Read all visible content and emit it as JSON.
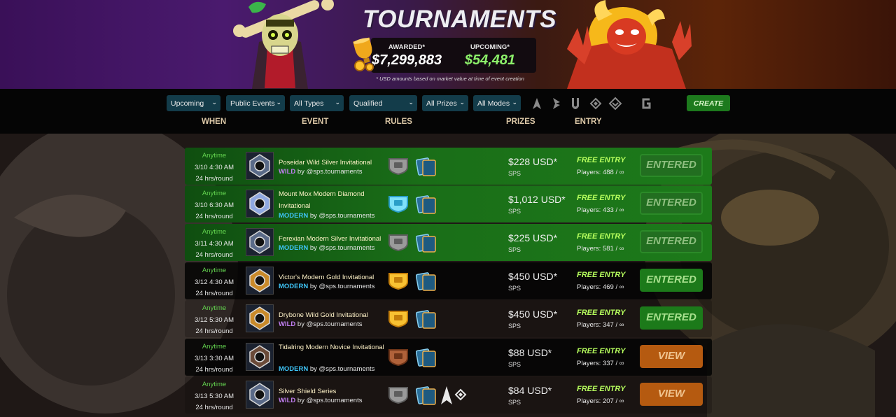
{
  "header": {
    "title": "TOURNAMENTS",
    "awarded_label": "AWARDED*",
    "awarded_value": "$7,299,883",
    "upcoming_label": "UPCOMING*",
    "upcoming_value": "$54,481",
    "footnote": "* USD amounts based on market value at time of event creation"
  },
  "filters": {
    "status": "Upcoming",
    "visibility": "Public Events",
    "types": "All Types",
    "rules": "Qualified",
    "prizes": "All Prizes",
    "modes": "All Modes",
    "create_label": "CREATE",
    "format_icons": [
      "format-a-icon",
      "format-b-icon",
      "format-u-icon",
      "format-diamond-icon",
      "format-chevron-icon",
      "format-g-icon"
    ]
  },
  "columns": {
    "when": "WHEN",
    "event": "EVENT",
    "rules": "RULES",
    "prizes": "PRIZES",
    "entry": "ENTRY"
  },
  "rows": [
    {
      "style": "green",
      "when": [
        "Anytime",
        "3/10 4:30 AM",
        "24 hrs/round"
      ],
      "title": "Poseidar Wild Silver Invitational",
      "format": "WILD",
      "by": "by @sps.tournaments",
      "league": "silver",
      "prize": "$228 USD*",
      "token": "SPS",
      "entry": "FREE ENTRY",
      "players": "Players: 488 / ∞",
      "action": "ENTERED",
      "action_style": "entered-faded"
    },
    {
      "style": "green",
      "when": [
        "Anytime",
        "3/10 6:30 AM",
        "24 hrs/round"
      ],
      "title": "Mount Mox Modern Diamond Invitational",
      "format": "MODERN",
      "by": "by @sps.tournaments",
      "league": "diamond",
      "prize": "$1,012 USD*",
      "token": "SPS",
      "entry": "FREE ENTRY",
      "players": "Players: 433 / ∞",
      "action": "ENTERED",
      "action_style": "entered-faded"
    },
    {
      "style": "green",
      "when": [
        "Anytime",
        "3/11 4:30 AM",
        "24 hrs/round"
      ],
      "title": "Ferexian Modern Silver Invitational",
      "format": "MODERN",
      "by": "by @sps.tournaments",
      "league": "silver",
      "prize": "$225 USD*",
      "token": "SPS",
      "entry": "FREE ENTRY",
      "players": "Players: 581 / ∞",
      "action": "ENTERED",
      "action_style": "entered-faded"
    },
    {
      "style": "dark",
      "when": [
        "Anytime",
        "3/12 4:30 AM",
        "24 hrs/round"
      ],
      "title": "Victor's Modern Gold Invitational",
      "format": "MODERN",
      "by": "by @sps.tournaments",
      "league": "gold",
      "prize": "$450 USD*",
      "token": "SPS",
      "entry": "FREE ENTRY",
      "players": "Players: 469 / ∞",
      "action": "ENTERED",
      "action_style": "entered"
    },
    {
      "style": "trans",
      "when": [
        "Anytime",
        "3/12 5:30 AM",
        "24 hrs/round"
      ],
      "title": "Drybone Wild Gold Invitational",
      "format": "WILD",
      "by": "by @sps.tournaments",
      "league": "gold",
      "prize": "$450 USD*",
      "token": "SPS",
      "entry": "FREE ENTRY",
      "players": "Players: 347 / ∞",
      "action": "ENTERED",
      "action_style": "entered"
    },
    {
      "style": "dark",
      "when": [
        "Anytime",
        "3/13 3:30 AM",
        "24 hrs/round"
      ],
      "title": "Tidalring Modern Novice Invitational",
      "format": "MODERN",
      "by": "by @sps.tournaments",
      "league": "bronze",
      "prize": "$88 USD*",
      "token": "SPS",
      "entry": "FREE ENTRY",
      "players": "Players: 337 / ∞",
      "action": "VIEW",
      "action_style": "view"
    },
    {
      "style": "trans",
      "when": [
        "Anytime",
        "3/13 5:30 AM",
        "24 hrs/round"
      ],
      "title": "Silver Shield Series",
      "format": "WILD",
      "by": "by @sps.tournaments",
      "league": "silver",
      "prize": "$84 USD*",
      "token": "SPS",
      "entry": "FREE ENTRY",
      "players": "Players: 207 / ∞",
      "action": "VIEW",
      "action_style": "view",
      "extra_rules": true
    }
  ]
}
